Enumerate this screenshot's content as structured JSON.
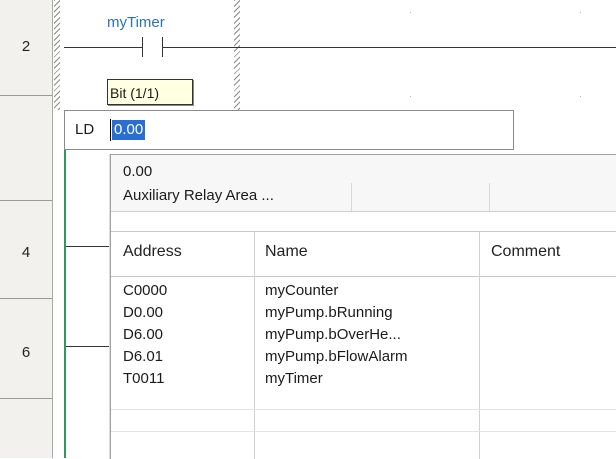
{
  "rungs": [
    {
      "number": "2"
    },
    {
      "number": "4"
    },
    {
      "number": "6"
    }
  ],
  "contact": {
    "label": "myTimer"
  },
  "tooltip": {
    "text": "Bit (1/1)"
  },
  "editor": {
    "mnemonic": "LD",
    "value": "0.00"
  },
  "suggestion": {
    "address": "0.00",
    "description": "Auxiliary Relay Area ..."
  },
  "table": {
    "headers": {
      "address": "Address",
      "name": "Name",
      "comment": "Comment"
    },
    "rows": [
      {
        "address": "C0000",
        "name": "myCounter",
        "comment": ""
      },
      {
        "address": "D0.00",
        "name": "myPump.bRunning",
        "comment": ""
      },
      {
        "address": "D6.00",
        "name": "myPump.bOverHe...",
        "comment": ""
      },
      {
        "address": "D6.01",
        "name": "myPump.bFlowAlarm",
        "comment": ""
      },
      {
        "address": "T0011",
        "name": "myTimer",
        "comment": ""
      }
    ]
  },
  "colors": {
    "power_rail": "#2e9a56",
    "contact_label": "#2a73b8",
    "selection": "#2b6ed3",
    "tooltip_bg": "#ffffe1"
  }
}
